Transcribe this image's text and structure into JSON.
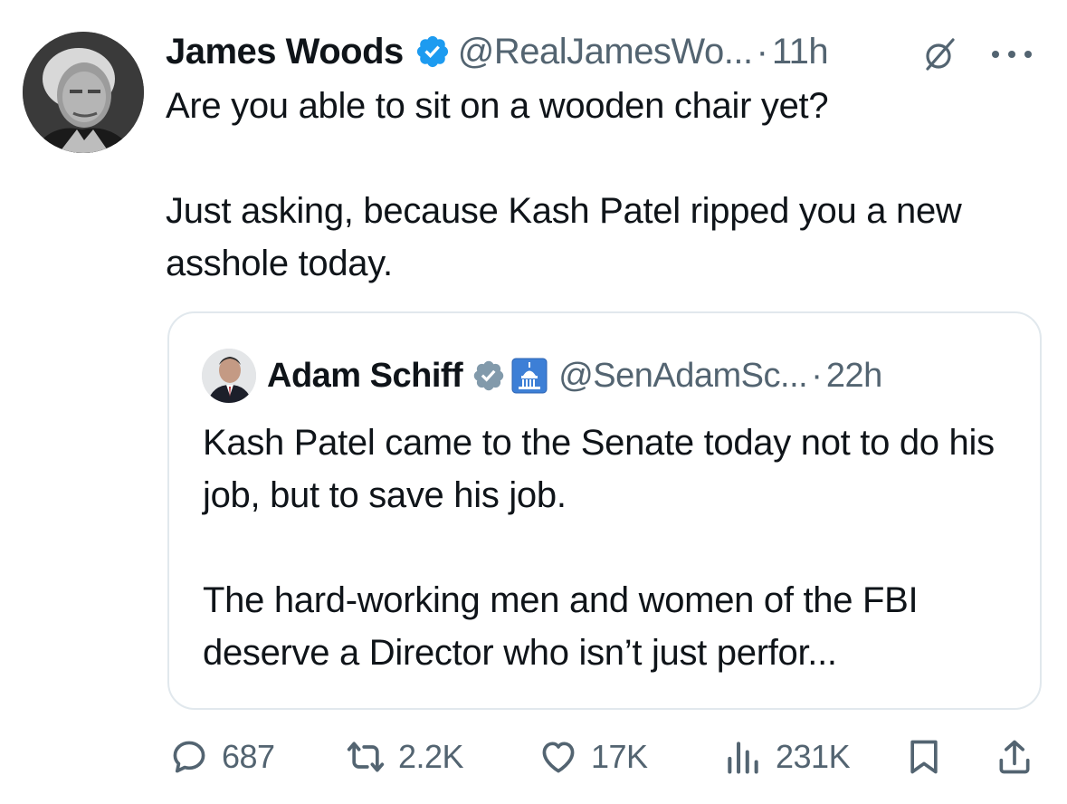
{
  "tweet": {
    "author_name": "James Woods",
    "handle": "@RealJamesWo...",
    "separator": "·",
    "time": "11h",
    "paragraphs": [
      "Are you able to sit on a wooden chair yet?",
      "Just asking, because Kash Patel ripped you a new asshole today."
    ]
  },
  "quoted_tweet": {
    "author_name": "Adam Schiff",
    "handle": "@SenAdamSc...",
    "separator": "·",
    "time": "22h",
    "paragraphs": [
      "Kash Patel came to the Senate today not to do his job, but to save his job.",
      "The hard-working men and women of the FBI deserve a Director who isn’t just perfor..."
    ]
  },
  "actions": {
    "replies": "687",
    "reposts": "2.2K",
    "likes": "17K",
    "views": "231K"
  },
  "icons": {
    "verified": "verified-badge-icon",
    "grok": "grok-icon",
    "more": "more-icon",
    "capitol": "capitol-badge-icon",
    "reply": "reply-icon",
    "repost": "repost-icon",
    "like": "heart-icon",
    "views": "views-icon",
    "bookmark": "bookmark-icon",
    "share": "share-icon"
  },
  "colors": {
    "text": "#0f1419",
    "secondary": "#536471",
    "verified_blue": "#1d9bf0",
    "verified_gray": "#829aab",
    "border": "#e1e8ed"
  }
}
